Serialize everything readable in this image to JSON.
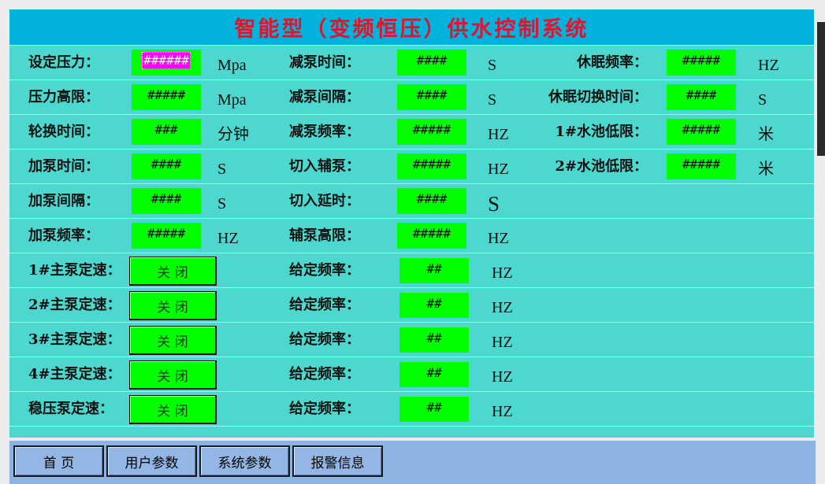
{
  "title": "智能型（变频恒压）供水控制系统",
  "params": {
    "left": [
      {
        "label": "设定压力：",
        "value": "######",
        "unit": "Mpa"
      },
      {
        "label": "压力高限：",
        "value": "#####",
        "unit": "Mpa"
      },
      {
        "label": "轮换时间：",
        "value": "###",
        "unit": "分钟"
      },
      {
        "label": "加泵时间：",
        "value": "####",
        "unit": "S"
      },
      {
        "label": "加泵间隔：",
        "value": "####",
        "unit": "S"
      },
      {
        "label": "加泵频率：",
        "value": "#####",
        "unit": "HZ"
      }
    ],
    "middle": [
      {
        "label": "减泵时间：",
        "value": "####",
        "unit": "S"
      },
      {
        "label": "减泵间隔：",
        "value": "####",
        "unit": "S"
      },
      {
        "label": "减泵频率：",
        "value": "#####",
        "unit": "HZ"
      },
      {
        "label": "切入辅泵：",
        "value": "#####",
        "unit": "HZ"
      },
      {
        "label": "切入延时：",
        "value": "####",
        "unit": "S"
      },
      {
        "label": "辅泵高限：",
        "value": "#####",
        "unit": "HZ"
      }
    ],
    "right": [
      {
        "label": "休眠频率：",
        "value": "#####",
        "unit": "HZ"
      },
      {
        "label": "休眠切换时间：",
        "value": "####",
        "unit": "S"
      },
      {
        "label": "1#水池低限：",
        "value": "#####",
        "unit": "米"
      },
      {
        "label": "2#水池低限：",
        "value": "#####",
        "unit": "米"
      }
    ]
  },
  "pumps": [
    {
      "label": "1#主泵定速：",
      "state": "关 闭",
      "freq_label": "给定频率：",
      "freq_value": "##",
      "unit": "HZ"
    },
    {
      "label": "2#主泵定速：",
      "state": "关 闭",
      "freq_label": "给定频率：",
      "freq_value": "##",
      "unit": "HZ"
    },
    {
      "label": "3#主泵定速：",
      "state": "关 闭",
      "freq_label": "给定频率：",
      "freq_value": "##",
      "unit": "HZ"
    },
    {
      "label": "4#主泵定速：",
      "state": "关 闭",
      "freq_label": "给定频率：",
      "freq_value": "##",
      "unit": "HZ"
    },
    {
      "label": "稳压泵定速：",
      "state": "关 闭",
      "freq_label": "给定频率：",
      "freq_value": "##",
      "unit": "HZ"
    }
  ],
  "nav": [
    {
      "label": "首 页"
    },
    {
      "label": "用户参数"
    },
    {
      "label": "系统参数"
    },
    {
      "label": "报警信息"
    }
  ],
  "colors": {
    "title_bar": "#00b2dc",
    "title_text": "#e8102a",
    "panel": "#4cd8cf",
    "field": "#00ff00",
    "focus_highlight": "#ff00ff",
    "nav_bar": "#8db3e2"
  }
}
